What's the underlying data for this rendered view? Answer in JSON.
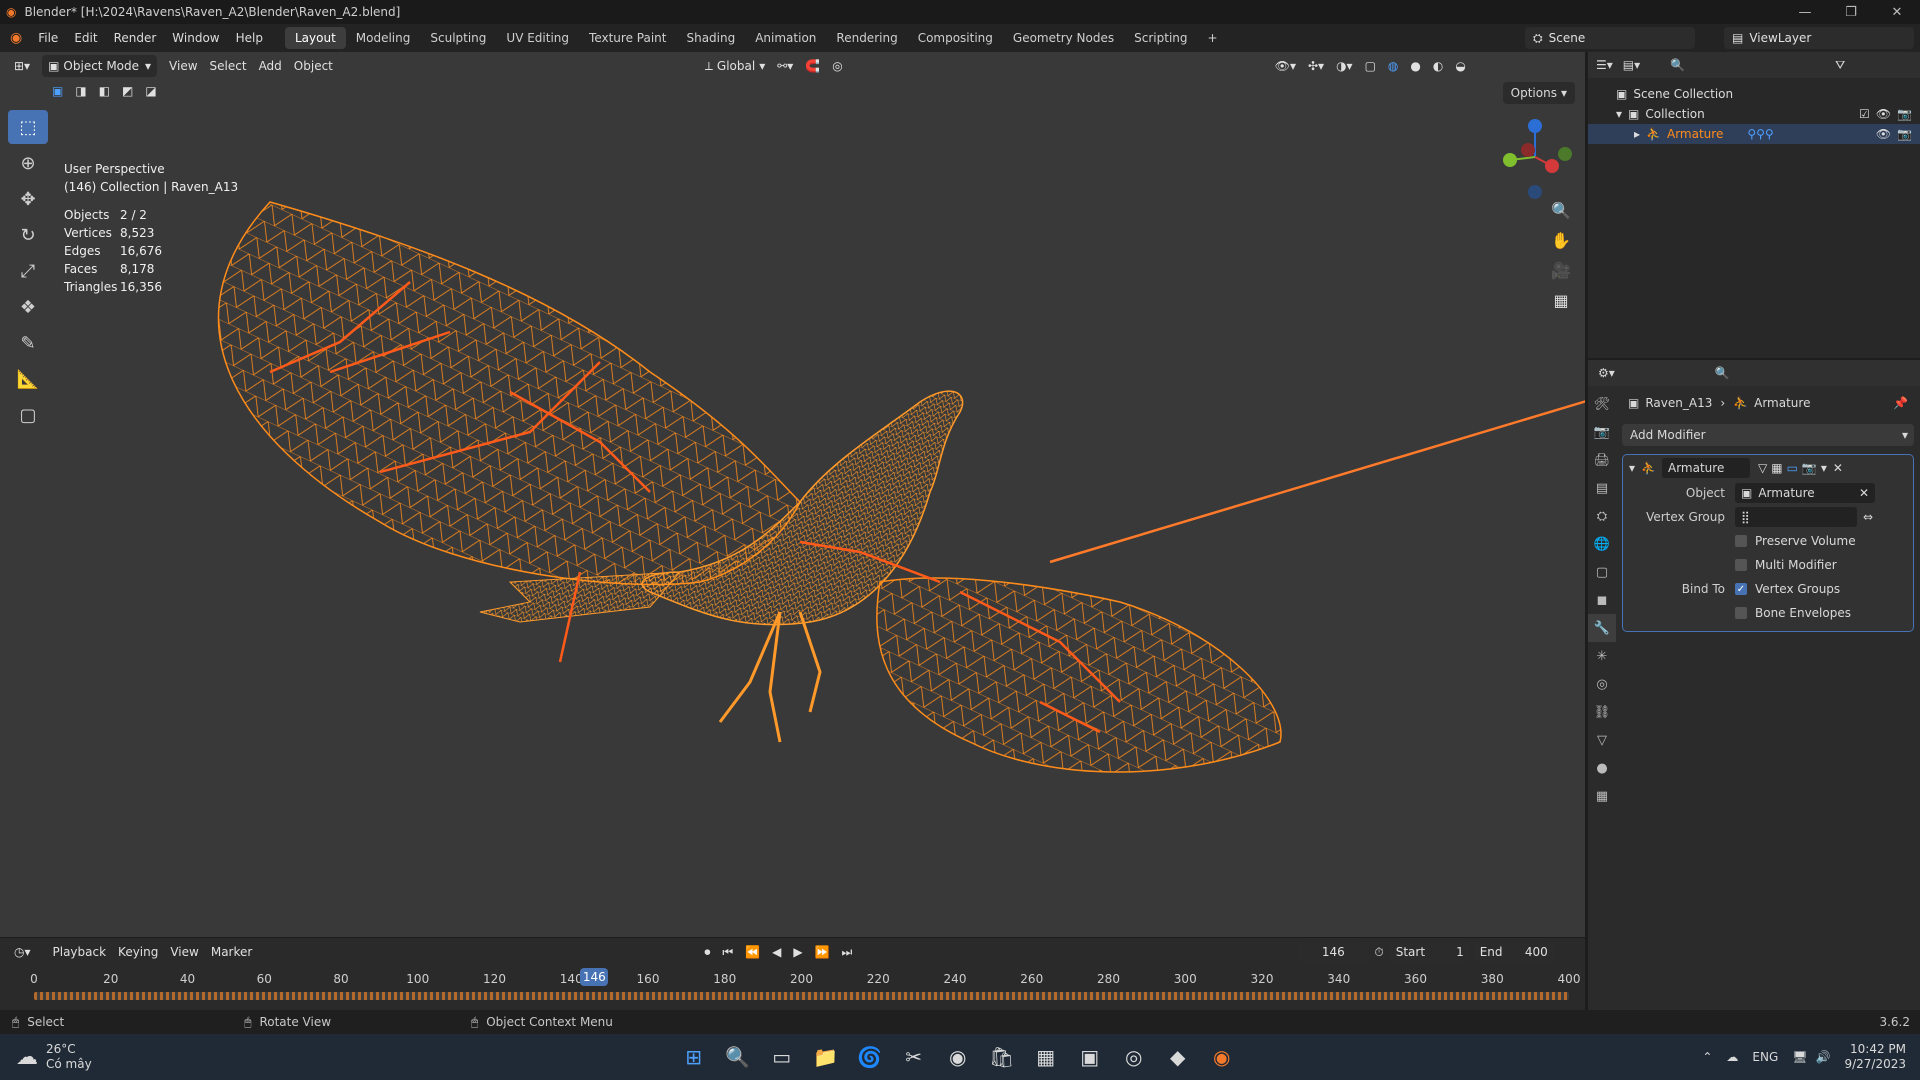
{
  "window": {
    "title": "Blender* [H:\\2024\\Ravens\\Raven_A2\\Blender\\Raven_A2.blend]"
  },
  "menu": [
    "File",
    "Edit",
    "Render",
    "Window",
    "Help"
  ],
  "workspaces": [
    "Layout",
    "Modeling",
    "Sculpting",
    "UV Editing",
    "Texture Paint",
    "Shading",
    "Animation",
    "Rendering",
    "Compositing",
    "Geometry Nodes",
    "Scripting"
  ],
  "active_workspace": "Layout",
  "scene": {
    "name": "Scene",
    "view_layer": "ViewLayer"
  },
  "viewport": {
    "mode": "Object Mode",
    "menus": [
      "View",
      "Select",
      "Add",
      "Object"
    ],
    "orientation": "Global",
    "options_label": "Options",
    "overlay": {
      "perspective": "User Perspective",
      "collection": "(146) Collection | Raven_A13"
    },
    "stats": [
      {
        "label": "Objects",
        "value": "2 / 2"
      },
      {
        "label": "Vertices",
        "value": "8,523"
      },
      {
        "label": "Edges",
        "value": "16,676"
      },
      {
        "label": "Faces",
        "value": "8,178"
      },
      {
        "label": "Triangles",
        "value": "16,356"
      }
    ],
    "wire_color": "#ff8c1a",
    "bone_color": "#ff5a1a"
  },
  "outliner": {
    "scene_collection": "Scene Collection",
    "collection": "Collection",
    "armature": "Armature"
  },
  "properties": {
    "object_name": "Raven_A13",
    "data_name": "Armature",
    "add_modifier": "Add Modifier",
    "modifier": {
      "name": "Armature",
      "object_label": "Object",
      "object_value": "Armature",
      "vertex_group_label": "Vertex Group",
      "preserve_volume": "Preserve Volume",
      "multi_modifier": "Multi Modifier",
      "bind_to_label": "Bind To",
      "vertex_groups": "Vertex Groups",
      "bone_envelopes": "Bone Envelopes"
    }
  },
  "timeline": {
    "menus": [
      "Playback",
      "Keying",
      "View",
      "Marker"
    ],
    "current_frame": "146",
    "start_label": "Start",
    "start": "1",
    "end_label": "End",
    "end": "400",
    "ticks": [
      "0",
      "20",
      "40",
      "60",
      "80",
      "100",
      "120",
      "140",
      "160",
      "180",
      "200",
      "220",
      "240",
      "260",
      "280",
      "300",
      "320",
      "340",
      "360",
      "380",
      "400"
    ]
  },
  "statusbar": {
    "select": "Select",
    "rotate": "Rotate View",
    "context": "Object Context Menu",
    "version": "3.6.2"
  },
  "taskbar": {
    "temp": "26°C",
    "weather": "Có mây",
    "lang": "ENG",
    "time": "10:42 PM",
    "date": "9/27/2023"
  }
}
